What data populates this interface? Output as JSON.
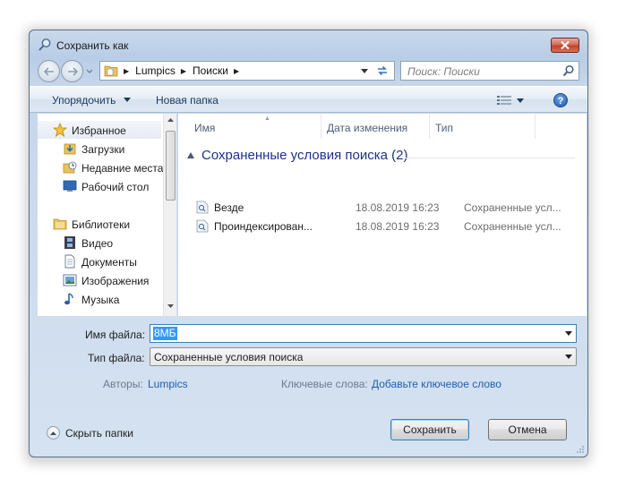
{
  "window": {
    "title": "Сохранить как"
  },
  "address": {
    "breadcrumbs": [
      "Lumpics",
      "Поиски"
    ],
    "search_placeholder": "Поиск: Поиски"
  },
  "toolbar": {
    "organize_label": "Упорядочить",
    "new_folder_label": "Новая папка",
    "help_label": "?"
  },
  "nav": {
    "favorites_label": "Избранное",
    "favorites": [
      "Загрузки",
      "Недавние места",
      "Рабочий стол"
    ],
    "libraries_label": "Библиотеки",
    "libraries": [
      "Видео",
      "Документы",
      "Изображения",
      "Музыка"
    ]
  },
  "content": {
    "columns": [
      "Имя",
      "Дата изменения",
      "Тип"
    ],
    "group_header": "Сохраненные условия поиска (2)",
    "files": [
      {
        "name": "Везде",
        "date": "18.08.2019 16:23",
        "type": "Сохраненные усл..."
      },
      {
        "name": "Проиндексирован...",
        "date": "18.08.2019 16:23",
        "type": "Сохраненные усл..."
      }
    ]
  },
  "form": {
    "filename_label": "Имя файла:",
    "filename_value": "8МБ",
    "filetype_label": "Тип файла:",
    "filetype_value": "Сохраненные условия поиска",
    "authors_label": "Авторы:",
    "authors_value": "Lumpics",
    "keywords_label": "Ключевые слова:",
    "keywords_value": "Добавьте ключевое слово"
  },
  "footer": {
    "hide_folders_label": "Скрыть папки",
    "save_label": "Сохранить",
    "cancel_label": "Отмена"
  },
  "colors": {
    "accent_link": "#1f5fb0",
    "group_header": "#1e3287",
    "selection": "#3399ff"
  }
}
